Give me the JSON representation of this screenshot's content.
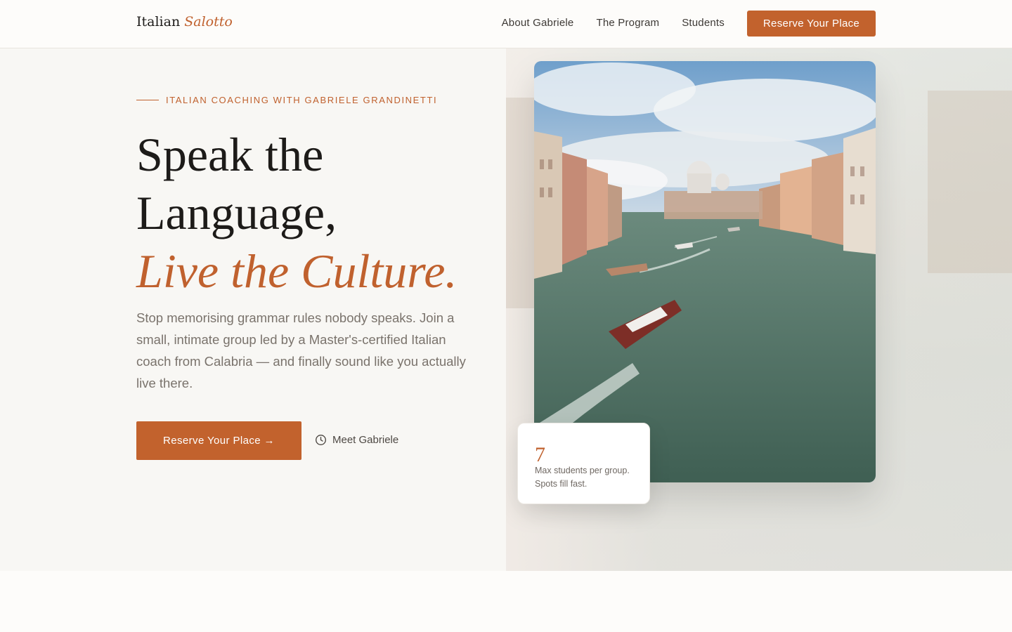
{
  "brand": {
    "name": "Italian",
    "accent": "Salotto"
  },
  "nav": {
    "links": [
      "About Gabriele",
      "The Program",
      "Students"
    ],
    "cta": "Reserve Your Place"
  },
  "hero": {
    "eyebrow": "ITALIAN COACHING WITH GABRIELE GRANDINETTI",
    "headline": {
      "line1": "Speak the",
      "line2": "Language,",
      "line3": "Live the Culture."
    },
    "lede": "Stop memorising grammar rules nobody speaks. Join a small, intimate group led by a Master's-certified Italian coach from Calabria — and finally sound like you actually live there.",
    "cta_primary": "Reserve Your Place →",
    "cta_secondary": "Meet Gabriele",
    "stat": {
      "number": "7",
      "label": "Max students per group. Spots fill fast."
    }
  },
  "icons": {
    "secondary": "clock-icon",
    "photo": "venice-canal-photo"
  },
  "colors": {
    "accent": "#c2622d",
    "text": "#1d1b19",
    "muted": "#7a736c",
    "background": "#f8f7f4"
  }
}
